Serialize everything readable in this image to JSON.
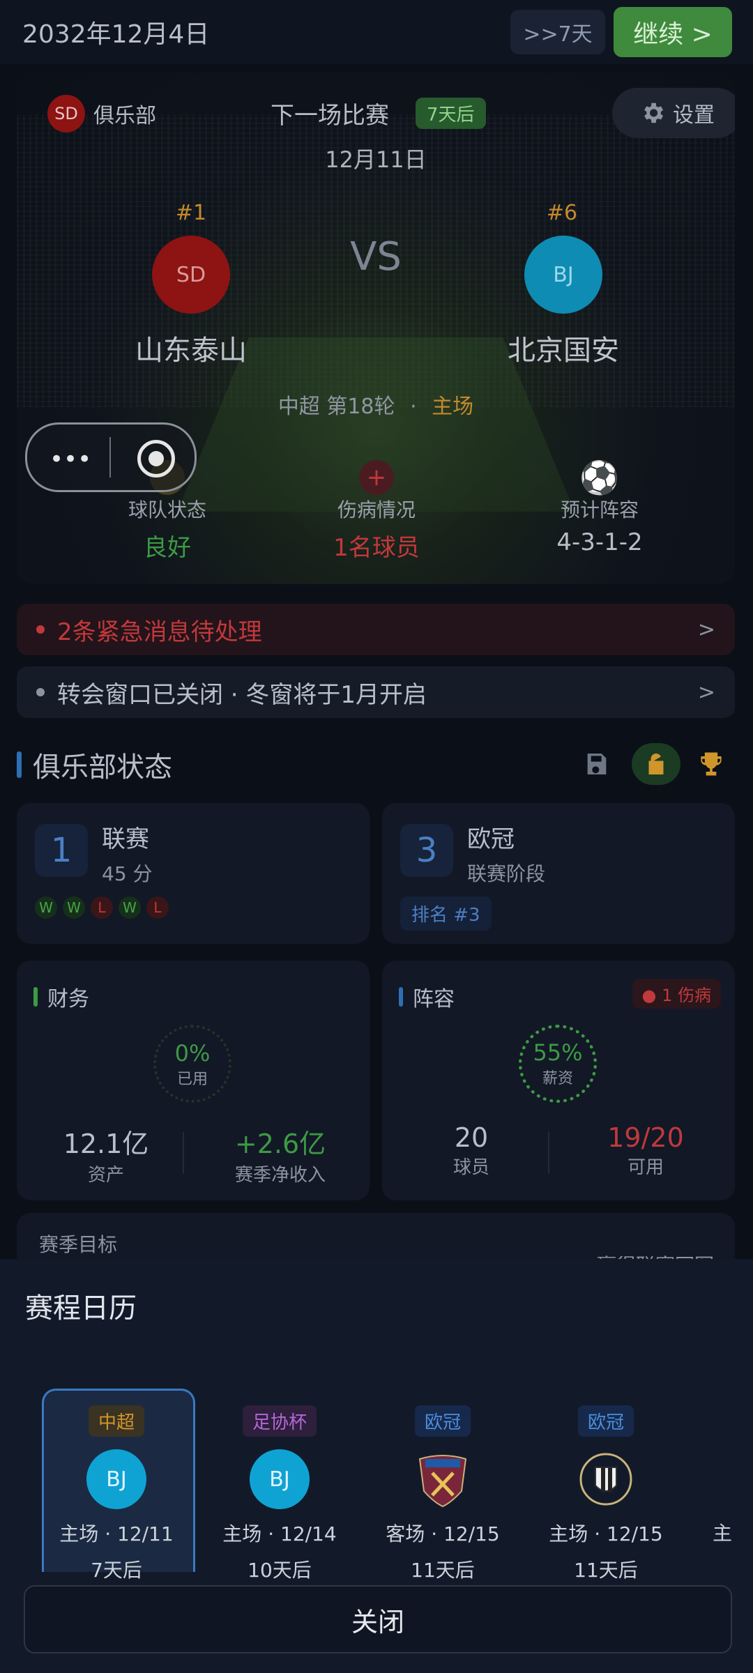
{
  "topbar": {
    "date": "2032年12月4日",
    "skip_label": ">>7天",
    "continue_label": "继续 >"
  },
  "hero": {
    "club_badge": "SD",
    "club_label": "俱乐部",
    "next_match_label": "下一场比赛",
    "countdown": "7天后",
    "settings_label": "设置",
    "match_date": "12月11日",
    "vs": "VS",
    "home": {
      "rank": "#1",
      "badge": "SD",
      "name": "山东泰山",
      "color": "#8e1313"
    },
    "away": {
      "rank": "#6",
      "badge": "BJ",
      "name": "北京国安",
      "color": "#0e8cb4"
    },
    "league": "中超 第18轮",
    "separator": "·",
    "venue": "主场",
    "stats": [
      {
        "label": "球队状态",
        "value": "良好",
        "color": "#3d9a44"
      },
      {
        "label": "伤病情况",
        "value": "1名球员",
        "color": "#c2383c"
      },
      {
        "label": "预计阵容",
        "value": "4-3-1-2",
        "color": "#b8bdc7"
      }
    ]
  },
  "alerts": [
    {
      "text": "2条紧急消息待处理",
      "chevron": ">",
      "color": "#c0393c"
    },
    {
      "text": "转会窗口已关闭 · 冬窗将于1月开启",
      "chevron": ">",
      "color": "#b9bfca"
    }
  ],
  "club_status": {
    "title": "俱乐部状态",
    "league_card": {
      "rank": "1",
      "title": "联赛",
      "sub": "45 分",
      "form": [
        "W",
        "W",
        "L",
        "W",
        "L"
      ]
    },
    "ucl_card": {
      "rank": "3",
      "title": "欧冠",
      "sub": "联赛阶段",
      "tag": "排名 #3"
    },
    "finance": {
      "title": "财务",
      "percent": "0%",
      "percent_label": "已用",
      "assets": "12.1亿",
      "assets_label": "资产",
      "net": "+2.6亿",
      "net_label": "赛季净收入"
    },
    "squad": {
      "title": "阵容",
      "injury_badge": "1 伤病",
      "percent": "55%",
      "percent_label": "薪资",
      "players": "20",
      "players_label": "球员",
      "available": "19/20",
      "available_label": "可用"
    },
    "season_goal_label": "赛季目标",
    "season_goal_right": "赢得联赛冠军"
  },
  "schedule": {
    "title": "赛程日历",
    "fixtures": [
      {
        "comp": "中超",
        "badge": "BJ",
        "info": "主场 · 12/11",
        "days": "7天后"
      },
      {
        "comp": "足协杯",
        "badge": "BJ",
        "info": "主场 · 12/14",
        "days": "10天后"
      },
      {
        "comp": "欧冠",
        "badge": "",
        "info": "客场 · 12/15",
        "days": "11天后"
      },
      {
        "comp": "欧冠",
        "badge": "",
        "info": "主场 · 12/15",
        "days": "11天后"
      }
    ],
    "partial_next": "主",
    "close_label": "关闭"
  }
}
